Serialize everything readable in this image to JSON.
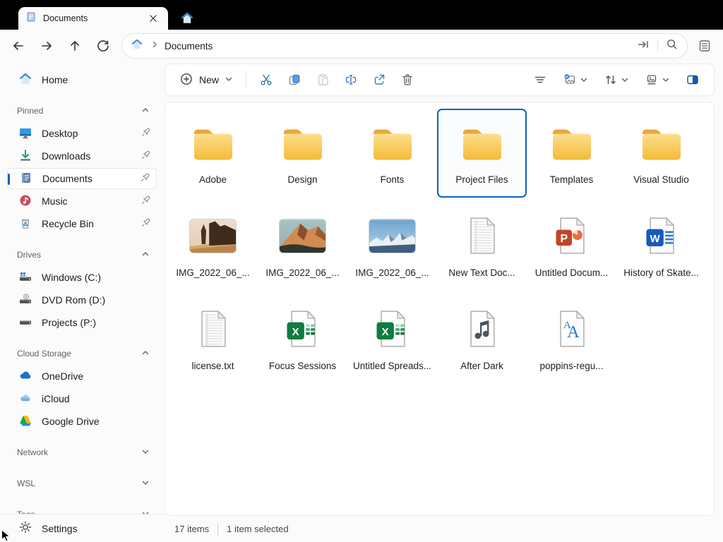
{
  "window": {
    "tab_title": "Documents",
    "tab_icon": "document-tab-icon",
    "new_tab_icon": "home-tab-icon"
  },
  "navbar": {
    "breadcrumb": "Documents",
    "icons": [
      "back",
      "forward",
      "up",
      "refresh",
      "home",
      "go-to",
      "search",
      "tasks"
    ]
  },
  "toolbar": {
    "new_label": "New",
    "actions": [
      "cut-icon",
      "copy-icon",
      "paste-icon",
      "rename-icon",
      "share-icon",
      "delete-icon"
    ],
    "view_controls": [
      "filter-icon",
      "selection-icon",
      "sort-icon",
      "view-icon",
      "preview-pane-icon"
    ]
  },
  "sidebar": {
    "home": {
      "label": "Home",
      "icon": "home"
    },
    "sections": [
      {
        "label": "Pinned",
        "expanded": true,
        "items": [
          {
            "label": "Desktop",
            "icon": "desktop",
            "pinned": true
          },
          {
            "label": "Downloads",
            "icon": "downloads",
            "pinned": true
          },
          {
            "label": "Documents",
            "icon": "documents",
            "pinned": true,
            "selected": true
          },
          {
            "label": "Music",
            "icon": "music",
            "pinned": true
          },
          {
            "label": "Recycle Bin",
            "icon": "recycle-bin",
            "pinned": true
          }
        ]
      },
      {
        "label": "Drives",
        "expanded": true,
        "items": [
          {
            "label": "Windows (C:)",
            "icon": "drive-windows"
          },
          {
            "label": "DVD Rom (D:)",
            "icon": "drive-dvd"
          },
          {
            "label": "Projects (P:)",
            "icon": "drive"
          }
        ]
      },
      {
        "label": "Cloud Storage",
        "expanded": true,
        "items": [
          {
            "label": "OneDrive",
            "icon": "onedrive"
          },
          {
            "label": "iCloud",
            "icon": "icloud"
          },
          {
            "label": "Google Drive",
            "icon": "google-drive"
          }
        ]
      },
      {
        "label": "Network",
        "expanded": false,
        "items": []
      },
      {
        "label": "WSL",
        "expanded": false,
        "items": []
      },
      {
        "label": "Tags",
        "expanded": false,
        "items": []
      }
    ],
    "settings_label": "Settings"
  },
  "files": {
    "items": [
      {
        "label": "Adobe",
        "icon": "folder"
      },
      {
        "label": "Design",
        "icon": "folder"
      },
      {
        "label": "Fonts",
        "icon": "folder"
      },
      {
        "label": "Project Files",
        "icon": "folder",
        "selected": true
      },
      {
        "label": "Templates",
        "icon": "folder"
      },
      {
        "label": "Visual Studio",
        "icon": "folder"
      },
      {
        "label": "IMG_2022_06_...",
        "icon": "image-desert"
      },
      {
        "label": "IMG_2022_06_...",
        "icon": "image-mountain"
      },
      {
        "label": "IMG_2022_06_...",
        "icon": "image-snow"
      },
      {
        "label": "New Text Doc...",
        "icon": "text-file"
      },
      {
        "label": "Untitled Docum...",
        "icon": "powerpoint"
      },
      {
        "label": "History of Skate...",
        "icon": "word"
      },
      {
        "label": "license.txt",
        "icon": "text-file"
      },
      {
        "label": "Focus Sessions",
        "icon": "excel"
      },
      {
        "label": "Untitled Spreads...",
        "icon": "excel"
      },
      {
        "label": "After Dark",
        "icon": "audio"
      },
      {
        "label": "poppins-regu...",
        "icon": "font-file"
      }
    ]
  },
  "statusbar": {
    "items_count": "17 items",
    "selection": "1 item selected"
  },
  "colors": {
    "accent": "#0B63B8",
    "titlebar": "#000000",
    "window_bg": "#FBFBFB",
    "card_bg": "#FFFFFF",
    "folder_flap": "#E9A73E",
    "folder_top": "#FFDF8D",
    "folder_bottom": "#F2BB38",
    "word_blue": "#185ABD",
    "excel_green": "#107C41",
    "powerpoint_red": "#C4442A"
  }
}
